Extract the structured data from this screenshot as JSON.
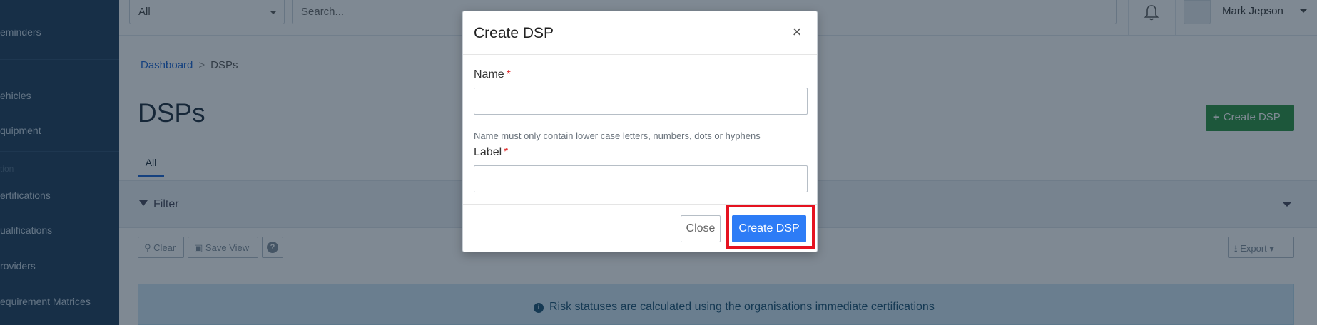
{
  "sidebar": {
    "items": [
      {
        "label": "eminders"
      },
      {
        "label": "ehicles"
      },
      {
        "label": "quipment"
      },
      {
        "label": "ertifications"
      },
      {
        "label": "ualifications"
      },
      {
        "label": "roviders"
      },
      {
        "label": "equirement Matrices"
      }
    ],
    "section_label": "tion"
  },
  "topbar": {
    "select_value": "All",
    "search_placeholder": "Search...",
    "user_name": "Mark Jepson"
  },
  "breadcrumb": {
    "home": "Dashboard",
    "separator": ">",
    "current": "DSPs"
  },
  "page": {
    "title": "DSPs",
    "create_button": "Create DSP",
    "tab_all": "All",
    "filter_label": "Filter"
  },
  "toolbar": {
    "clear": "Clear",
    "save_view": "Save View",
    "help": "?",
    "export": "Export"
  },
  "info": {
    "message": "Risk statuses are calculated using the organisations immediate certifications"
  },
  "modal": {
    "title": "Create DSP",
    "close_icon": "×",
    "name_label": "Name",
    "name_value": "",
    "name_help": "Name must only contain lower case letters, numbers, dots or hyphens",
    "label_label": "Label",
    "label_value": "",
    "required_marker": "*",
    "close_button": "Close",
    "create_button": "Create DSP"
  },
  "colors": {
    "primary": "#2d7cf6",
    "success": "#3a9b4f",
    "highlight": "#e51220",
    "sidebar": "#2e4a66"
  }
}
